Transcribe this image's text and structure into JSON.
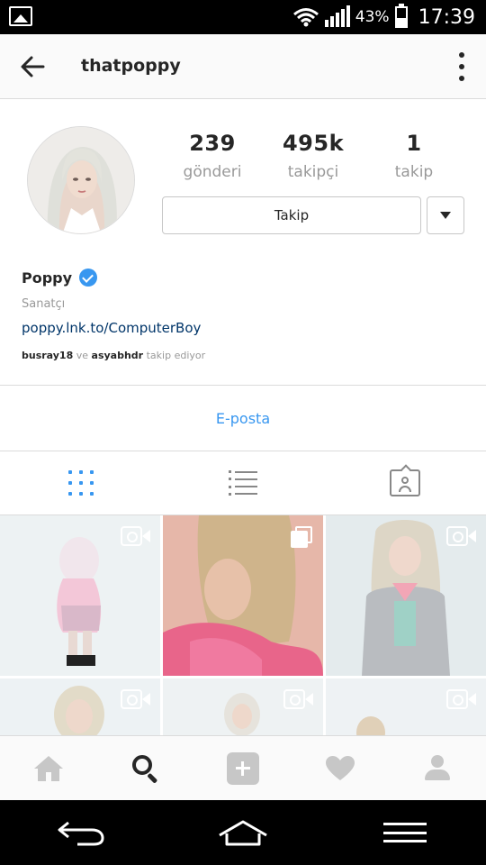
{
  "status_bar": {
    "battery_text": "43%",
    "battery_level": 0.43,
    "time": "17:39"
  },
  "header": {
    "username": "thatpoppy"
  },
  "profile": {
    "stats": [
      {
        "value": "239",
        "label": "gönderi"
      },
      {
        "value": "495k",
        "label": "takipçi"
      },
      {
        "value": "1",
        "label": "takip"
      }
    ],
    "follow_label": "Takip",
    "name": "Poppy",
    "verified": true,
    "category": "Sanatçı",
    "link": "poppy.lnk.to/ComputerBoy",
    "followed_by": {
      "user1": "busray18",
      "conj": "ve",
      "user2": "asyabhdr",
      "suffix": "takip ediyor"
    },
    "email_label": "E-posta"
  },
  "tabs": [
    {
      "icon": "grid-icon",
      "active": true
    },
    {
      "icon": "list-icon",
      "active": false
    },
    {
      "icon": "tagged-icon",
      "active": false
    }
  ],
  "grid": [
    {
      "type": "video"
    },
    {
      "type": "carousel"
    },
    {
      "type": "video"
    },
    {
      "type": "video"
    },
    {
      "type": "video"
    },
    {
      "type": "video"
    }
  ],
  "bottom_nav": [
    {
      "icon": "home-icon"
    },
    {
      "icon": "search-icon",
      "active": true
    },
    {
      "icon": "add-icon"
    },
    {
      "icon": "heart-icon"
    },
    {
      "icon": "person-icon"
    }
  ],
  "colors": {
    "accent": "#3897f0",
    "link": "#003569",
    "muted": "#999999",
    "border": "#dbdbdb"
  }
}
